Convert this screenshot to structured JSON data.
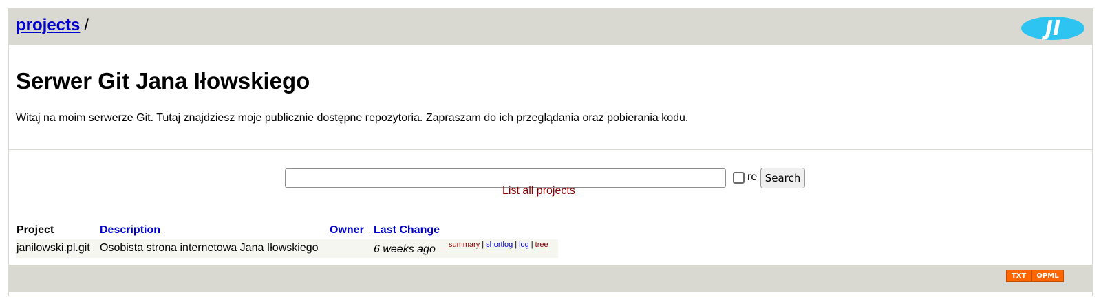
{
  "header": {
    "breadcrumb_link": "projects",
    "breadcrumb_separator": "/",
    "logo_icon": "ji-logo-icon",
    "logo_text": "JI",
    "header_bg": "#d9d8d1"
  },
  "site": {
    "title": "Serwer Git Jana Iłowskiego",
    "intro": "Witaj na moim serwerze Git. Tutaj znajdziesz moje publicznie dostępne repozytoria. Zapraszam do ich przeglądania oraz pobierania kodu."
  },
  "search": {
    "value": "",
    "regex_label": "re",
    "regex_checked": false,
    "button_label": "Search",
    "list_all_label": "List all projects"
  },
  "table": {
    "headers": {
      "project": "Project",
      "description": "Description",
      "owner": "Owner",
      "last_change": "Last Change"
    },
    "rows": [
      {
        "project": "janilowski.pl.git",
        "description": "Osobista strona internetowa Jana Iłowskiego",
        "owner": "",
        "age": "6 weeks ago",
        "actions": {
          "summary": "summary",
          "shortlog": "shortlog",
          "log": "log",
          "tree": "tree"
        }
      }
    ]
  },
  "footer": {
    "txt_label": "TXT",
    "opml_label": "OPML",
    "feed_color": "#ff6600"
  }
}
